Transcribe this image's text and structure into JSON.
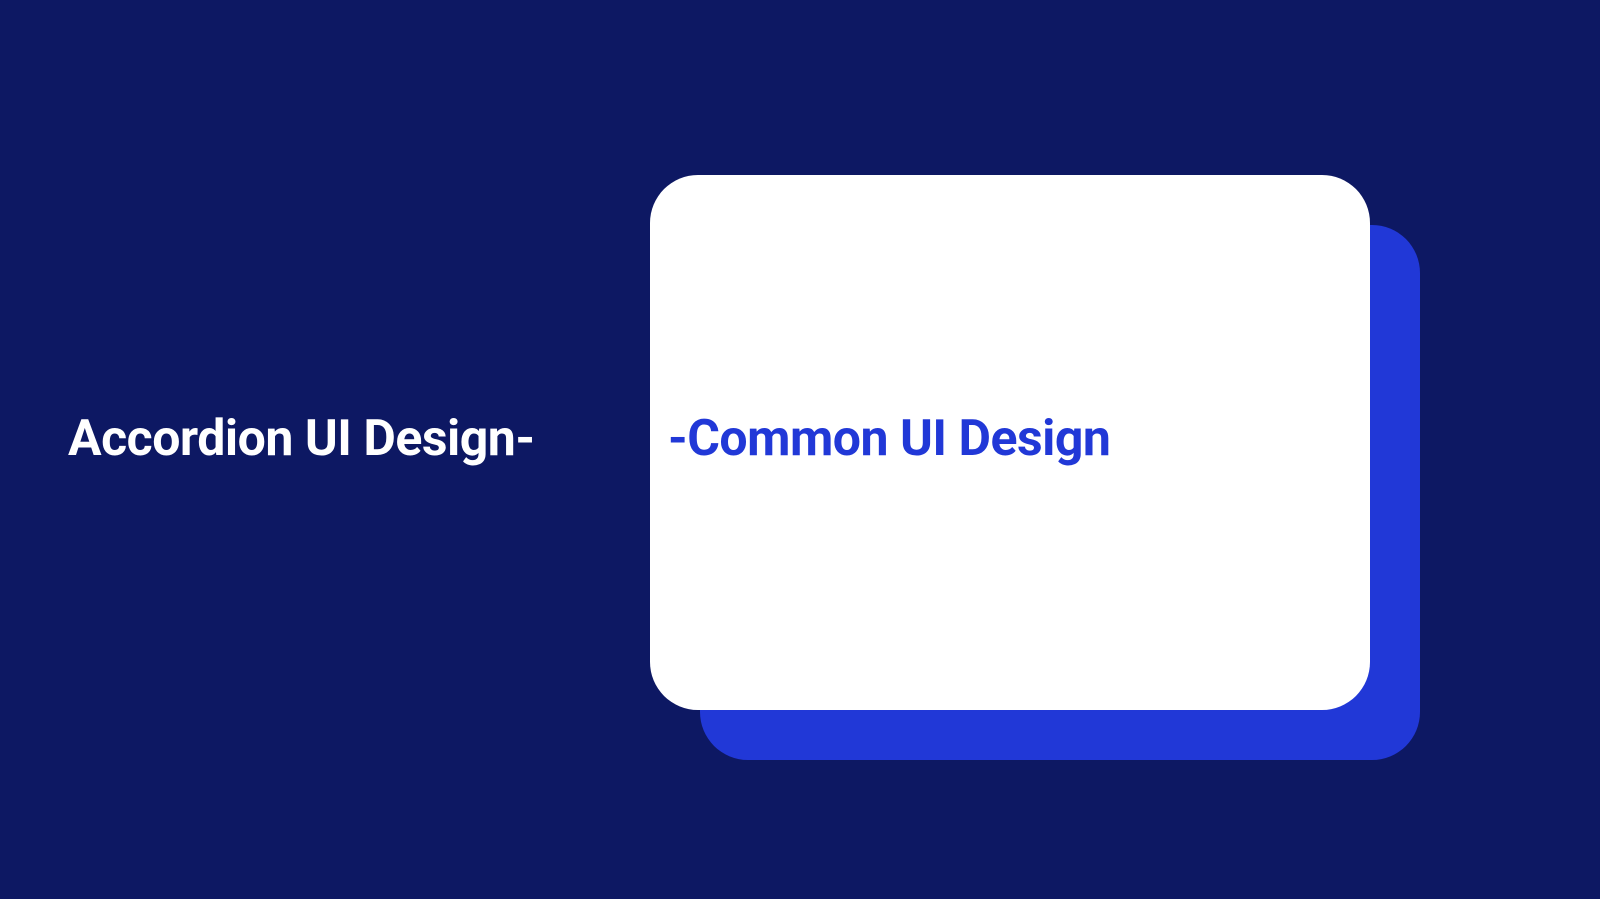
{
  "title": {
    "white_part": "Accordion UI Design-",
    "blue_part": "-Common UI Design"
  },
  "colors": {
    "background": "#0d1863",
    "card": "#ffffff",
    "card_shadow": "#2138d7",
    "text_white": "#ffffff",
    "text_blue": "#2138d7"
  }
}
